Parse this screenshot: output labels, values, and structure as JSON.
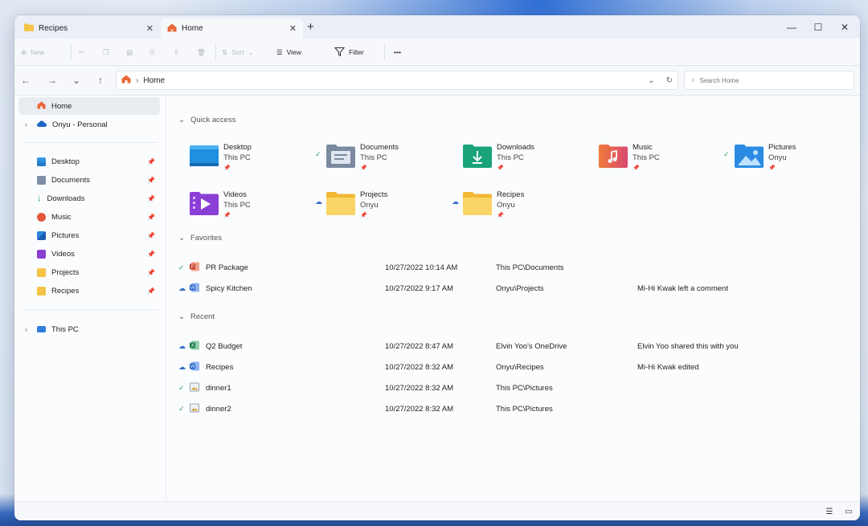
{
  "tabs": [
    {
      "label": "Recipes",
      "icon": "folder-icon"
    },
    {
      "label": "Home",
      "icon": "home-icon"
    }
  ],
  "toolbar": {
    "new": "New",
    "sort": "Sort",
    "view": "View",
    "filter": "Filter",
    "more": "•••"
  },
  "address": {
    "crumb": "Home",
    "search_placeholder": "Search Home"
  },
  "sidebar": {
    "home": "Home",
    "onedrive": "Onyu - Personal",
    "pinned": [
      "Desktop",
      "Documents",
      "Downloads",
      "Music",
      "Pictures",
      "Videos",
      "Projects",
      "Recipes"
    ],
    "this_pc": "This PC"
  },
  "quick_access": {
    "title": "Quick access",
    "items": [
      {
        "name": "Desktop",
        "loc": "This PC",
        "icon": "desktop-folder-icon",
        "status": ""
      },
      {
        "name": "Documents",
        "loc": "This PC",
        "icon": "documents-folder-icon",
        "status": "synced"
      },
      {
        "name": "Downloads",
        "loc": "This PC",
        "icon": "downloads-folder-icon",
        "status": ""
      },
      {
        "name": "Music",
        "loc": "This PC",
        "icon": "music-folder-icon",
        "status": ""
      },
      {
        "name": "Pictures",
        "loc": "Onyu",
        "icon": "pictures-folder-icon",
        "status": "synced"
      },
      {
        "name": "Videos",
        "loc": "This PC",
        "icon": "videos-folder-icon",
        "status": ""
      },
      {
        "name": "Projects",
        "loc": "Onyu",
        "icon": "folder-icon",
        "status": "cloud"
      },
      {
        "name": "Recipes",
        "loc": "Onyu",
        "icon": "folder-icon",
        "status": "cloud"
      }
    ]
  },
  "favorites": {
    "title": "Favorites",
    "rows": [
      {
        "name": "PR Package",
        "date": "10/27/2022 10:14 AM",
        "location": "This PC\\Documents",
        "activity": "",
        "status": "synced",
        "icon": "powerpoint-icon"
      },
      {
        "name": "Spicy Kitchen",
        "date": "10/27/2022 9:17 AM",
        "location": "Onyu\\Projects",
        "activity": "Mi-Hi Kwak left a comment",
        "status": "cloud",
        "icon": "word-icon"
      }
    ]
  },
  "recent": {
    "title": "Recent",
    "rows": [
      {
        "name": "Q2 Budget",
        "date": "10/27/2022 8:47 AM",
        "location": "Elvin Yoo's OneDrive",
        "activity": "Elvin Yoo shared this with you",
        "status": "cloud",
        "icon": "excel-icon"
      },
      {
        "name": "Recipes",
        "date": "10/27/2022 8:32 AM",
        "location": "Onyu\\Recipes",
        "activity": "Mi-Hi Kwak edited",
        "status": "cloud",
        "icon": "word-icon"
      },
      {
        "name": "dinner1",
        "date": "10/27/2022 8:32 AM",
        "location": "This PC\\Pictures",
        "activity": "",
        "status": "synced",
        "icon": "image-file-icon"
      },
      {
        "name": "dinner2",
        "date": "10/27/2022 8:32 AM",
        "location": "This PC\\Pictures",
        "activity": "",
        "status": "synced",
        "icon": "image-file-icon"
      }
    ]
  },
  "colors": {
    "folder_yellow": "#f7c948",
    "accent_blue": "#2f6fd6",
    "sync_green": "#2e9e4f"
  }
}
